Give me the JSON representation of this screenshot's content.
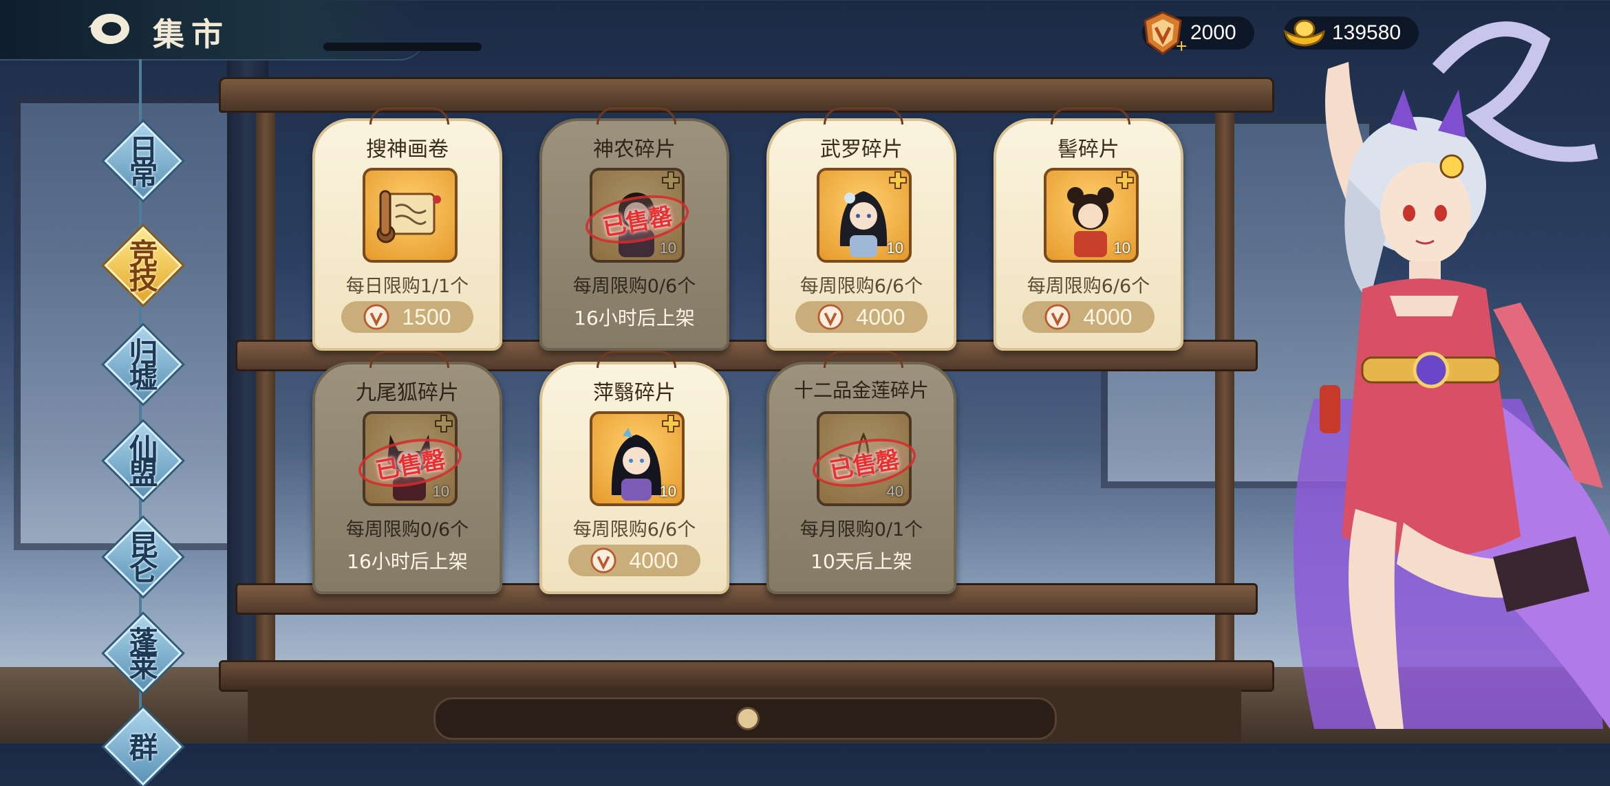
{
  "header": {
    "title": "集市"
  },
  "currency": [
    {
      "icon": "arena-token-icon",
      "value": "2000"
    },
    {
      "icon": "gold-ingot-icon",
      "value": "139580"
    }
  ],
  "sidebar": {
    "items": [
      {
        "label": "日常",
        "active": false
      },
      {
        "label": "竞技",
        "active": true
      },
      {
        "label": "归墟",
        "active": false
      },
      {
        "label": "仙盟",
        "active": false
      },
      {
        "label": "昆仑",
        "active": false
      },
      {
        "label": "蓬莱",
        "active": false
      },
      {
        "label": "群",
        "active": false
      }
    ]
  },
  "shop": {
    "sold_out_text": "已售罄",
    "items": [
      {
        "name": "搜神画卷",
        "icon": "scroll-icon",
        "limit": "每日限购1/1个",
        "price": "1500",
        "sold_out": false,
        "restock": ""
      },
      {
        "name": "神农碎片",
        "icon": "character-shard-icon",
        "limit": "每周限购0/6个",
        "price": "",
        "sold_out": true,
        "restock": "16小时后上架",
        "count": "10"
      },
      {
        "name": "武罗碎片",
        "icon": "character-shard-icon",
        "limit": "每周限购6/6个",
        "price": "4000",
        "sold_out": false,
        "restock": "",
        "count": "10"
      },
      {
        "name": "髻碎片",
        "icon": "character-shard-icon",
        "limit": "每周限购6/6个",
        "price": "4000",
        "sold_out": false,
        "restock": "",
        "count": "10"
      },
      {
        "name": "九尾狐碎片",
        "icon": "character-shard-icon",
        "limit": "每周限购0/6个",
        "price": "",
        "sold_out": true,
        "restock": "16小时后上架",
        "count": "10"
      },
      {
        "name": "萍翳碎片",
        "icon": "character-shard-icon",
        "limit": "每周限购6/6个",
        "price": "4000",
        "sold_out": false,
        "restock": "",
        "count": "10"
      },
      {
        "name": "十二品金莲碎片",
        "icon": "lotus-shard-icon",
        "limit": "每月限购0/1个",
        "price": "",
        "sold_out": true,
        "restock": "10天后上架",
        "count": "40"
      }
    ]
  },
  "colors": {
    "accent": "#e4a72c",
    "sold_out_red": "#e8302f",
    "card_bg": "#fbf3de"
  }
}
